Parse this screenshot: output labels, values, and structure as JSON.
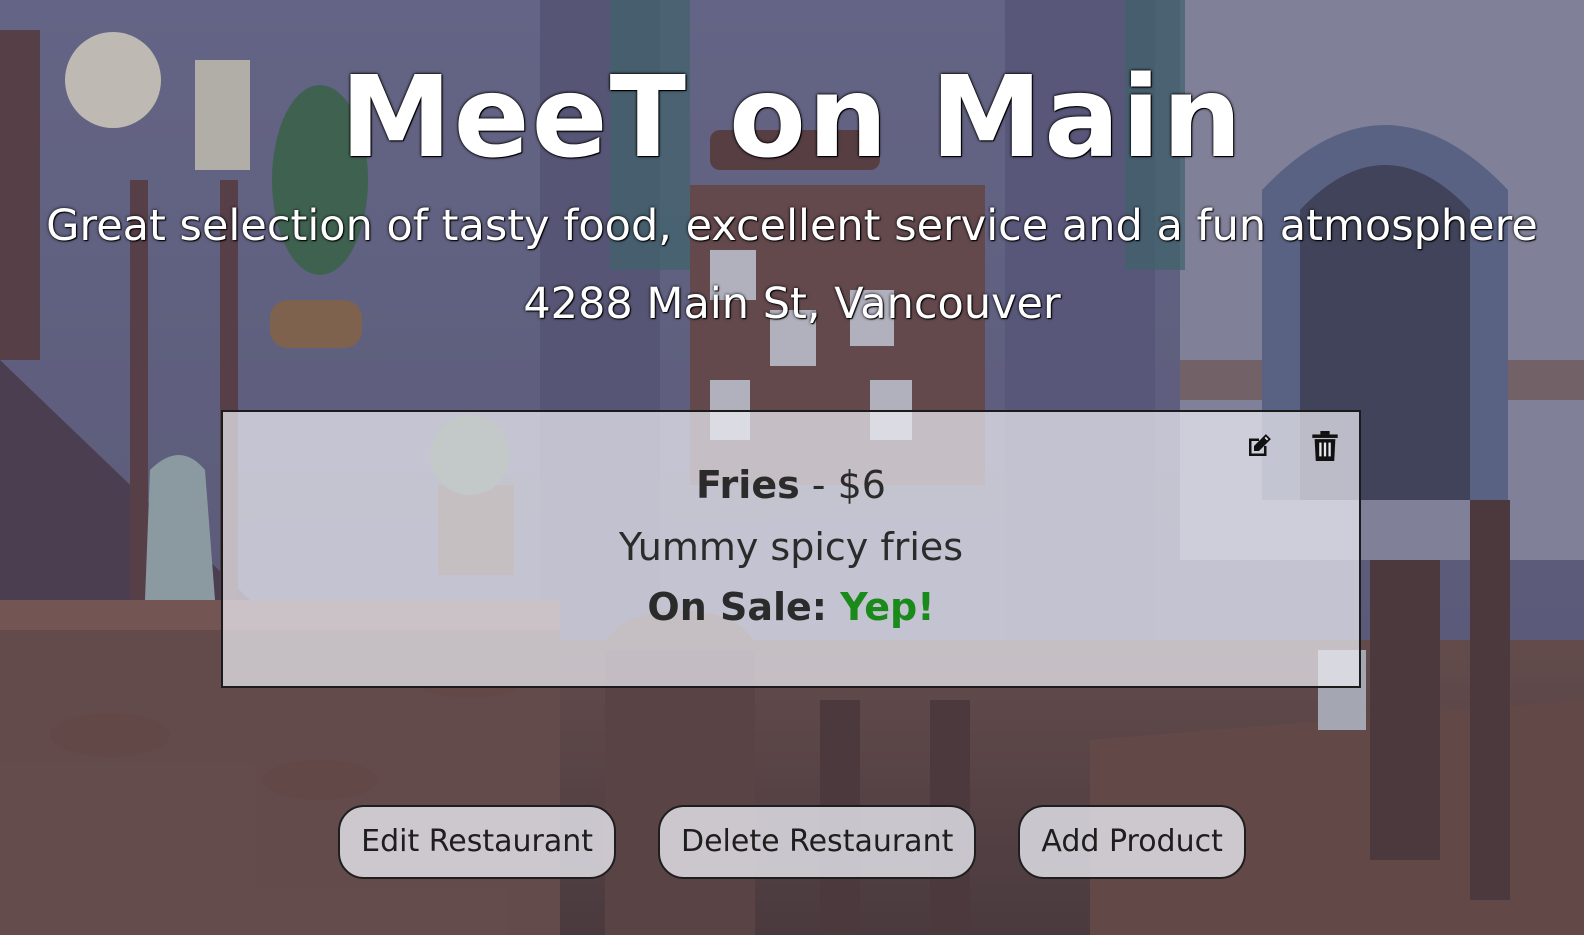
{
  "restaurant": {
    "name": "MeeT on Main",
    "description": "Great selection of tasty food, excellent service and a fun atmosphere",
    "address": "4288 Main St, Vancouver"
  },
  "products": [
    {
      "name": "Fries",
      "price_separator": " - ",
      "price": "$6",
      "description": "Yummy spicy fries",
      "sale_label": "On Sale:",
      "sale_value": "Yep!",
      "icons": [
        "edit-icon",
        "trash-icon"
      ]
    }
  ],
  "actions": {
    "edit_restaurant": "Edit Restaurant",
    "delete_restaurant": "Delete Restaurant",
    "add_product": "Add Product"
  },
  "colors": {
    "sale_value": "#1a8a1a",
    "card_background": "rgba(235,235,242,0.72)",
    "text": "#2b2b2b",
    "title": "#ffffff"
  }
}
